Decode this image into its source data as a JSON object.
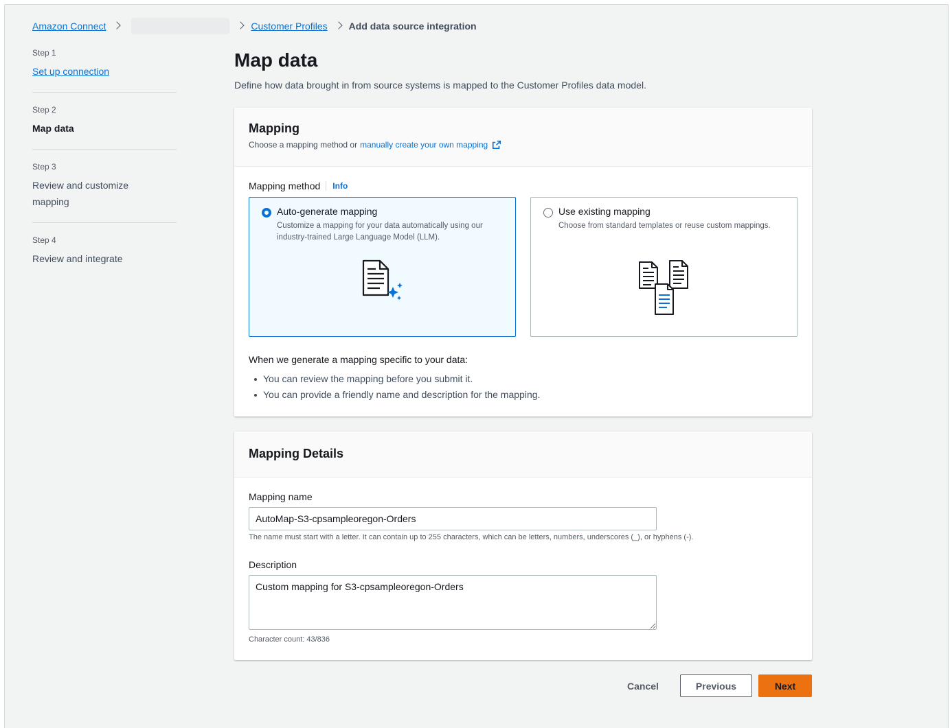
{
  "breadcrumb": {
    "items": [
      {
        "label": "Amazon Connect"
      },
      {
        "label": "Customer Profiles"
      },
      {
        "label": "Add data source integration"
      }
    ]
  },
  "steps": [
    {
      "num": "Step 1",
      "title": "Set up connection",
      "state": "link"
    },
    {
      "num": "Step 2",
      "title": "Map data",
      "state": "active"
    },
    {
      "num": "Step 3",
      "title": "Review and customize mapping",
      "state": "disabled"
    },
    {
      "num": "Step 4",
      "title": "Review and integrate",
      "state": "disabled"
    }
  ],
  "page": {
    "title": "Map data",
    "description": "Define how data brought in from source systems is mapped to the Customer Profiles data model."
  },
  "mapping": {
    "title": "Mapping",
    "subtitle_prefix": "Choose a mapping method or",
    "subtitle_link": "manually create your own mapping",
    "method_label": "Mapping method",
    "info_label": "Info",
    "options": [
      {
        "title": "Auto-generate mapping",
        "description": "Customize a mapping for your data automatically using our industry-trained Large Language Model (LLM).",
        "selected": true,
        "icon": "document-sparkle-icon"
      },
      {
        "title": "Use existing mapping",
        "description": "Choose from standard templates or reuse custom mappings.",
        "selected": false,
        "icon": "documents-stack-icon"
      }
    ],
    "note_intro": "When we generate a mapping specific to your data:",
    "notes": [
      "You can review the mapping before you submit it.",
      "You can provide a friendly name and description for the mapping."
    ]
  },
  "details": {
    "title": "Mapping Details",
    "name_label": "Mapping name",
    "name_value": "AutoMap-S3-cpsampleoregon-Orders",
    "name_hint": "The name must start with a letter. It can contain up to 255 characters, which can be letters, numbers, underscores (_), or hyphens (-).",
    "description_label": "Description",
    "description_value": "Custom mapping for S3-cpsampleoregon-Orders",
    "char_count": "Character count: 43/836"
  },
  "actions": {
    "cancel": "Cancel",
    "previous": "Previous",
    "next": "Next"
  },
  "colors": {
    "accent": "#0972d3",
    "primary_button": "#ec7211"
  }
}
